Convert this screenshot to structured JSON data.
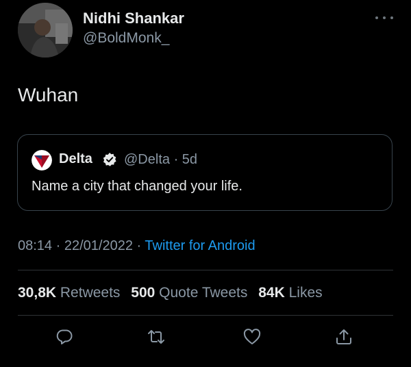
{
  "author": {
    "display_name": "Nidhi Shankar",
    "handle": "@BoldMonk_"
  },
  "tweet": {
    "text": "Wuhan",
    "time": "08:14",
    "separator1": "·",
    "date": "22/01/2022",
    "separator2": "·",
    "source": "Twitter for Android"
  },
  "quoted": {
    "name": "Delta",
    "handle": "@Delta",
    "separator": "·",
    "age": "5d",
    "text": "Name a city that changed your life."
  },
  "stats": {
    "retweets_count": "30,8K",
    "retweets_label": "Retweets",
    "quotes_count": "500",
    "quotes_label": "Quote Tweets",
    "likes_count": "84K",
    "likes_label": "Likes"
  },
  "icons": {
    "more": "more-horizontal-icon",
    "reply": "reply-icon",
    "retweet": "retweet-icon",
    "like": "heart-icon",
    "share": "share-icon",
    "verified": "verified-badge-icon",
    "delta_logo": "delta-logo-icon"
  },
  "colors": {
    "background": "#000000",
    "text": "#e7e9ea",
    "secondary_text": "#8b98a5",
    "link": "#1d9bf0",
    "border": "#38444d",
    "delta_red": "#c8102e"
  }
}
